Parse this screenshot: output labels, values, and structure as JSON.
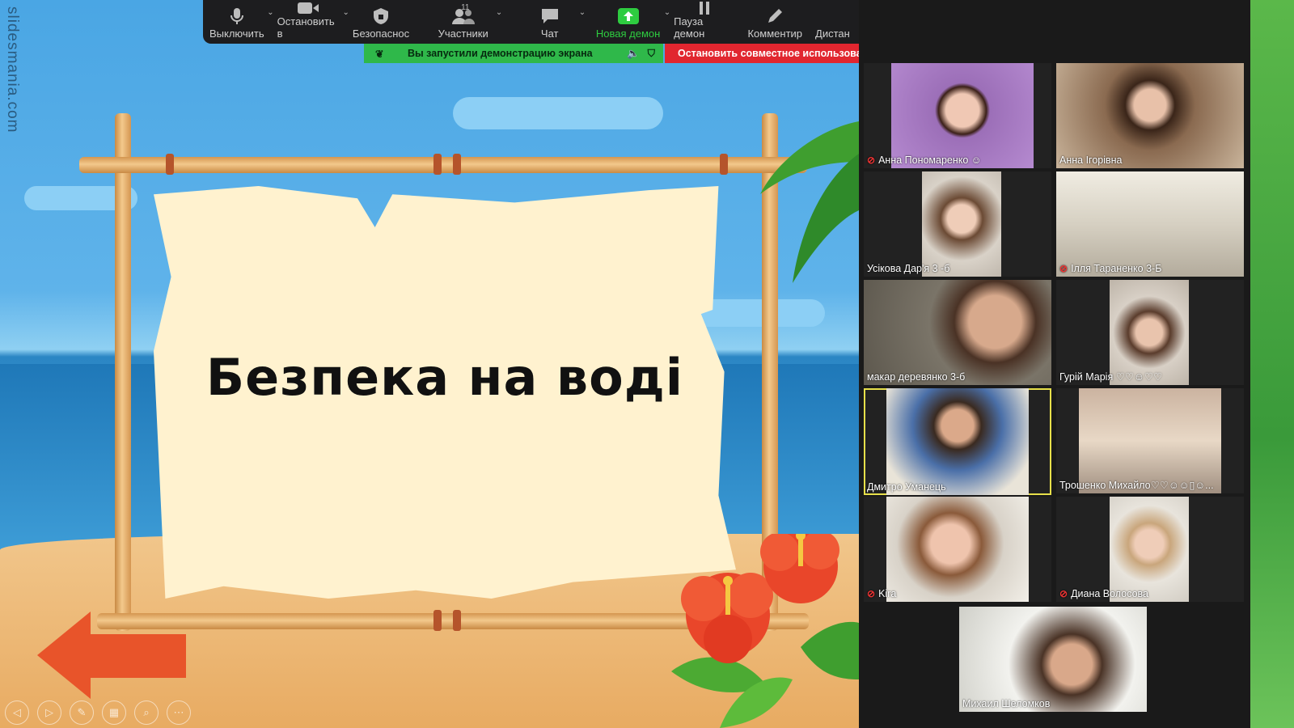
{
  "watermark": "slidesmania.com",
  "slide": {
    "title": "Безпека на воді",
    "nav": [
      "◁",
      "▷",
      "✎",
      "▦",
      "⌕",
      "⋯"
    ]
  },
  "toolbar": {
    "items": [
      {
        "label": "Выключить",
        "icon": "microphone-icon",
        "caret": true
      },
      {
        "label": "Остановить в",
        "icon": "video-camera-icon",
        "caret": true
      },
      {
        "label": "Безопаснос",
        "icon": "shield-icon",
        "caret": false
      },
      {
        "label": "Участники",
        "icon": "participants-icon",
        "caret": true,
        "count": "11"
      },
      {
        "label": "Чат",
        "icon": "chat-icon",
        "caret": true
      },
      {
        "label": "Новая демон",
        "icon": "share-screen-icon",
        "caret": true,
        "active": true
      },
      {
        "label": "Пауза демон",
        "icon": "pause-icon",
        "caret": false
      },
      {
        "label": "Комментир",
        "icon": "pen-icon",
        "caret": false
      },
      {
        "label": "Дистан",
        "icon": "",
        "caret": false
      }
    ],
    "share_status": "Вы запустили демонстрацию экрана",
    "stop_share": "Остановить совместное использование",
    "colors": {
      "share_green": "#2fb84a",
      "stop_red": "#e1262f",
      "active_speaker": "#e7e04a"
    }
  },
  "participants": [
    {
      "name": "Анна Пономаренко ☺",
      "muted": true
    },
    {
      "name": "Анна Ігорівна",
      "muted": false
    },
    {
      "name": "Усікова Дар'я 3 -б",
      "muted": false
    },
    {
      "name": "Ілля Тараненко 3-Б",
      "muted": true
    },
    {
      "name": "макар  деревянко 3-б",
      "muted": false
    },
    {
      "name": "Гурій Марія ♡♡☺♡♡",
      "muted": false
    },
    {
      "name": "Дмитро Уманець",
      "muted": false,
      "active": true
    },
    {
      "name": "Трошенко Михайло♡♡☺☺▯☺...",
      "muted": false
    },
    {
      "name": "Kira",
      "muted": true
    },
    {
      "name": "Диана Волосова",
      "muted": true
    },
    {
      "name": "Михаил Шеломков",
      "muted": false
    }
  ]
}
